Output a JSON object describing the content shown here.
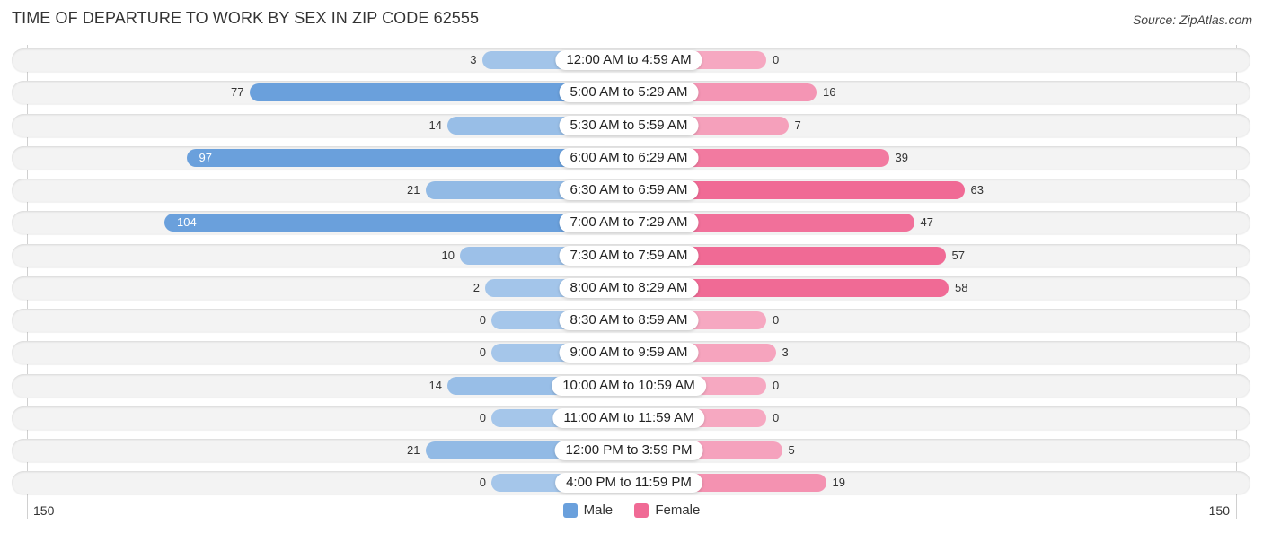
{
  "title": "TIME OF DEPARTURE TO WORK BY SEX IN ZIP CODE 62555",
  "source": "Source: ZipAtlas.com",
  "colors": {
    "male_strong": "#6aa0dc",
    "male_light": "#a5c6ea",
    "female_strong": "#f06a95",
    "female_light": "#f6a8c1"
  },
  "chart_data": {
    "type": "bar",
    "orientation": "horizontal-diverging",
    "title": "TIME OF DEPARTURE TO WORK BY SEX IN ZIP CODE 62555",
    "categories": [
      "12:00 AM to 4:59 AM",
      "5:00 AM to 5:29 AM",
      "5:30 AM to 5:59 AM",
      "6:00 AM to 6:29 AM",
      "6:30 AM to 6:59 AM",
      "7:00 AM to 7:29 AM",
      "7:30 AM to 7:59 AM",
      "8:00 AM to 8:29 AM",
      "8:30 AM to 8:59 AM",
      "9:00 AM to 9:59 AM",
      "10:00 AM to 10:59 AM",
      "11:00 AM to 11:59 AM",
      "12:00 PM to 3:59 PM",
      "4:00 PM to 11:59 PM"
    ],
    "series": [
      {
        "name": "Male",
        "values": [
          3,
          77,
          14,
          97,
          21,
          104,
          10,
          2,
          0,
          0,
          14,
          0,
          21,
          0
        ]
      },
      {
        "name": "Female",
        "values": [
          0,
          16,
          7,
          39,
          63,
          47,
          57,
          58,
          0,
          3,
          0,
          0,
          5,
          19
        ]
      }
    ],
    "axis": {
      "left_label": "150",
      "right_label": "150",
      "range": [
        150,
        150
      ]
    },
    "legend": {
      "position": "bottom-center",
      "entries": [
        "Male",
        "Female"
      ]
    },
    "grid": false
  }
}
